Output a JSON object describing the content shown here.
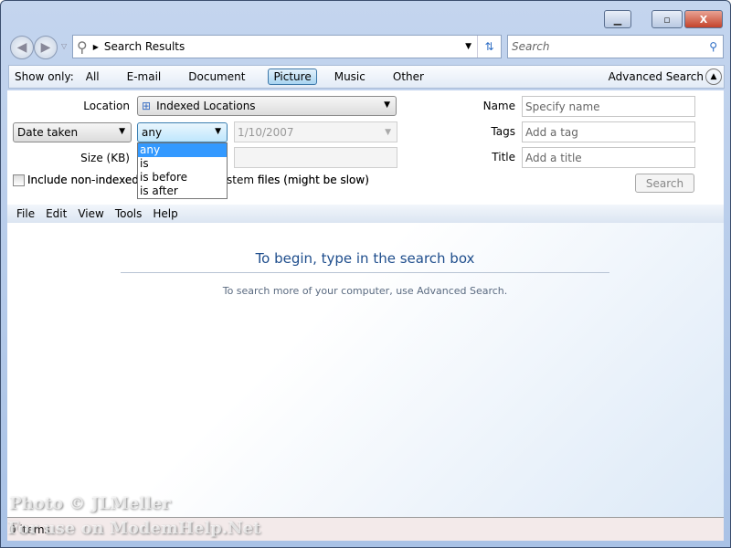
{
  "window": {
    "minimize": "▭",
    "maximize": "□",
    "close": "X"
  },
  "address": {
    "path": "Search Results"
  },
  "search": {
    "placeholder": "Search"
  },
  "filter": {
    "label": "Show only:",
    "items": [
      "All",
      "E-mail",
      "Document",
      "Picture",
      "Music",
      "Other"
    ],
    "active": "Picture",
    "advanced": "Advanced Search"
  },
  "form": {
    "location_label": "Location",
    "location_value": "Indexed Locations",
    "date_field": "Date taken",
    "date_op": "any",
    "date_value": "1/10/2007",
    "size_label": "Size (KB)",
    "include_label": "Include non-indexed, hidden, and system files (might be slow)",
    "include_visible_left": "Include non-indexed, H",
    "include_visible_right": "files (might be slow)",
    "name_label": "Name",
    "name_placeholder": "Specify name",
    "tags_label": "Tags",
    "tags_placeholder": "Add a tag",
    "title_label": "Title",
    "title_placeholder": "Add a title",
    "search_button": "Search",
    "dropdown_options": [
      "any",
      "is",
      "is before",
      "is after"
    ]
  },
  "menu": [
    "File",
    "Edit",
    "View",
    "Tools",
    "Help"
  ],
  "content": {
    "heading": "To begin, type in the search box",
    "sub": "To search more of your computer, use Advanced Search."
  },
  "status": {
    "items": "0 items"
  },
  "watermark": {
    "line1": "Photo © JLMeller",
    "line2": "For use on ModemHelp.Net"
  }
}
